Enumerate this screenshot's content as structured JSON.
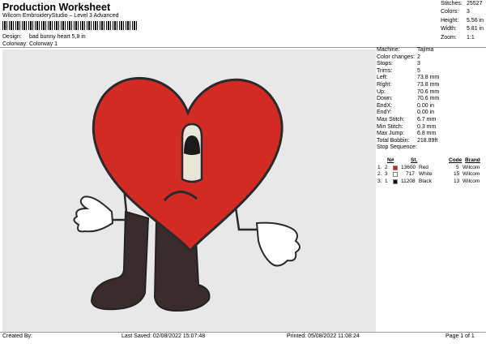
{
  "header": {
    "title": "Production Worksheet",
    "subtitle": "Wilcom EmbroideryStudio – Level 3 Advanced",
    "design_label": "Design:",
    "design_value": "bad bunny heart 5,8 in",
    "colorway_label": "Colorway:",
    "colorway_value": "Colorway 1"
  },
  "summary": [
    {
      "label": "Stitches:",
      "value": "25527"
    },
    {
      "label": "Colors:",
      "value": "3"
    },
    {
      "label": "Height:",
      "value": "5.56 in"
    },
    {
      "label": "Width:",
      "value": "5.81 in"
    },
    {
      "label": "Zoom:",
      "value": "1:1"
    }
  ],
  "machine_info": [
    {
      "label": "Machine:",
      "value": "Tajima"
    },
    {
      "label": "Color changes:",
      "value": "2"
    },
    {
      "label": "Stops:",
      "value": "3"
    },
    {
      "label": "Trims:",
      "value": "5"
    },
    {
      "label": "Left:",
      "value": "73.8 mm"
    },
    {
      "label": "Right:",
      "value": "73.8 mm"
    },
    {
      "label": "Up:",
      "value": "70.6 mm"
    },
    {
      "label": "Down:",
      "value": "70.6 mm"
    },
    {
      "label": "EndX:",
      "value": "0.00 in"
    },
    {
      "label": "EndY:",
      "value": "0.00 in"
    },
    {
      "label": "Max Stitch:",
      "value": "6.7 mm"
    },
    {
      "label": "Min Stitch:",
      "value": "0.3 mm"
    },
    {
      "label": "Max Jump:",
      "value": "6.8 mm"
    },
    {
      "label": "Total Bobbin:",
      "value": "218.89ft"
    }
  ],
  "stop_sequence": {
    "title": "Stop Sequence:",
    "headers": {
      "num": "N#",
      "st": "St.",
      "code": "Code",
      "brand": "Brand"
    },
    "rows": [
      {
        "idx": "1.",
        "n": "2",
        "st": "13600",
        "name": "Red",
        "code": "5",
        "brand": "Wilcom",
        "color": "#d42020"
      },
      {
        "idx": "2.",
        "n": "3",
        "st": "717",
        "name": "White",
        "code": "15",
        "brand": "Wilcom",
        "color": "#ffffff"
      },
      {
        "idx": "3.",
        "n": "1",
        "st": "11208",
        "name": "Black",
        "code": "13",
        "brand": "Wilcom",
        "color": "#111111"
      }
    ]
  },
  "footer": {
    "created": "Created By:",
    "saved": "Last Saved: 02/08/2022 15:07:48",
    "printed": "Printed: 05/08/2022 11:08:24",
    "page": "Page 1 of 1"
  },
  "colors": {
    "canvas": "#e8e8e8",
    "heart_red": "#d42a24",
    "legs_dark": "#3a2c2c"
  }
}
